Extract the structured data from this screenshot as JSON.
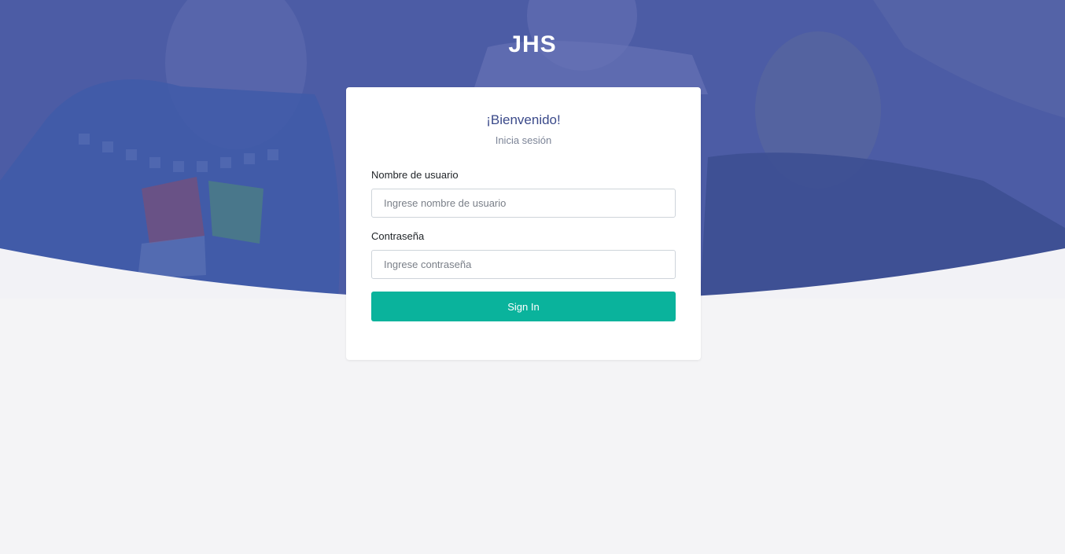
{
  "brand": {
    "logo_text": "JHS"
  },
  "colors": {
    "hero": "#4a5aa2",
    "accent": "#0ab39c",
    "heading": "#3b4a8a",
    "background": "#f4f4f6"
  },
  "login": {
    "welcome": "¡Bienvenido!",
    "subtitle": "Inicia sesión",
    "username_label": "Nombre de usuario",
    "username_placeholder": "Ingrese nombre de usuario",
    "username_value": "",
    "password_label": "Contraseña",
    "password_placeholder": "Ingrese contraseña",
    "password_value": "",
    "submit_label": "Sign In"
  }
}
